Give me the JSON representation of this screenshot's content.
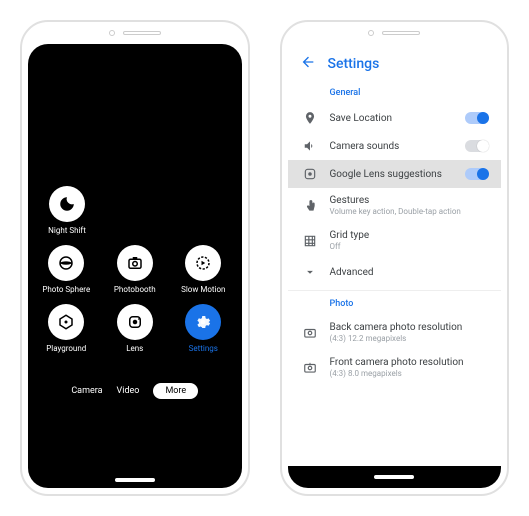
{
  "phone1": {
    "tiles": {
      "night_shift": "Night Shift",
      "photo_sphere": "Photo Sphere",
      "photobooth": "Photobooth",
      "slow_motion": "Slow Motion",
      "playground": "Playground",
      "lens": "Lens",
      "settings": "Settings"
    },
    "tabs": {
      "camera": "Camera",
      "video": "Video",
      "more": "More"
    }
  },
  "phone2": {
    "header": "Settings",
    "sections": {
      "general": "General",
      "photo": "Photo"
    },
    "rows": {
      "save_location": "Save Location",
      "camera_sounds": "Camera sounds",
      "lens_suggestions": "Google Lens suggestions",
      "gestures_title": "Gestures",
      "gestures_sub": "Volume key action, Double-tap action",
      "grid_title": "Grid type",
      "grid_sub": "Off",
      "advanced": "Advanced",
      "back_res_title": "Back camera photo resolution",
      "back_res_sub": "(4:3) 12.2 megapixels",
      "front_res_title": "Front camera photo resolution",
      "front_res_sub": "(4:3) 8.0 megapixels"
    }
  }
}
